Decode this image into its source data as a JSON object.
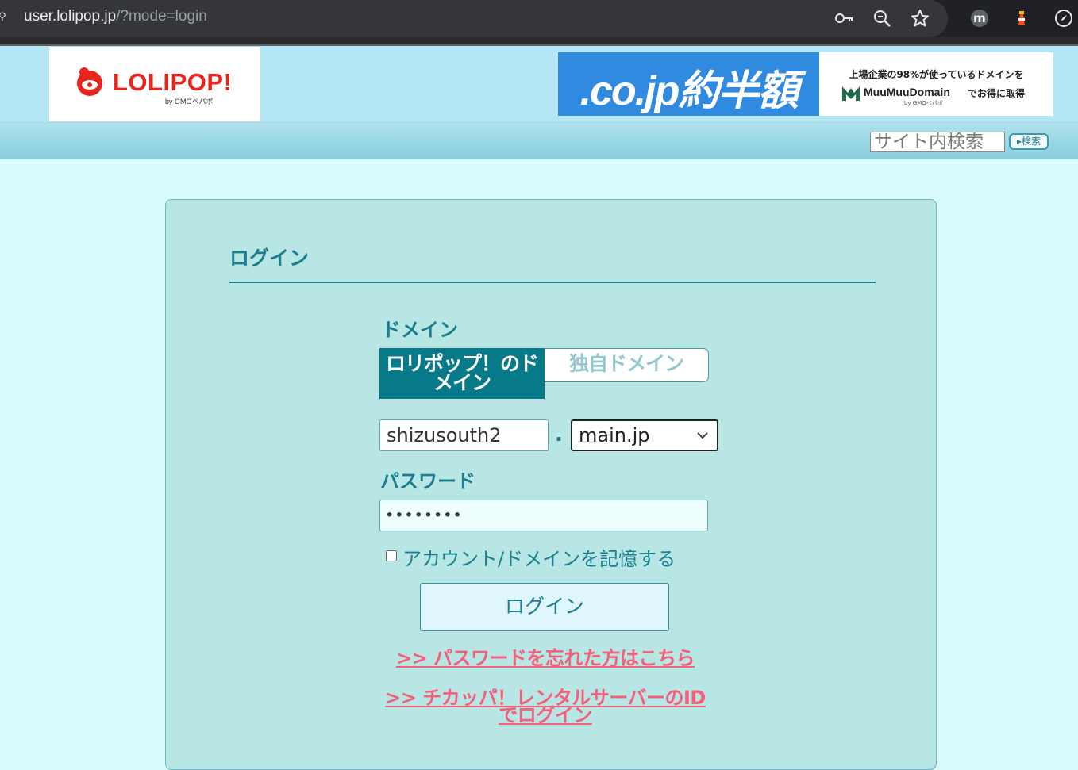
{
  "browser": {
    "url_host": "user.lolipop.jp",
    "url_path": "/?mode=login",
    "profile_initial": "m"
  },
  "header": {
    "logo_text": "LOLIPOP!",
    "logo_sub": "by GMOペパボ",
    "banner": {
      "main": ".co.jp約半額",
      "line1": "上場企業の98%が使っているドメインを",
      "brand": "MuuMuuDomain",
      "cta": "でお得に取得",
      "by": "by GMOペパボ",
      "bg_color": "#2f8ae0"
    }
  },
  "search": {
    "placeholder": "サイト内検索",
    "button_label": "▸検索"
  },
  "login": {
    "heading": "ログイン",
    "domain_label": "ドメイン",
    "tabs": [
      {
        "label": "ロリポップ！のドメイン",
        "active": true
      },
      {
        "label": "独自ドメイン",
        "active": false
      }
    ],
    "domain_value": "shizusouth2",
    "separator": ".",
    "tld_selected": "main.jp",
    "password_label": "パスワード",
    "password_value": "••••••••",
    "remember_label": "アカウント/ドメインを記憶する",
    "remember_checked": false,
    "submit_label": "ログイン",
    "links": [
      ">>  パスワードを忘れた方はこちら",
      ">>  チカッパ！レンタルサーバーのIDでログイン"
    ]
  },
  "colors": {
    "accent": "#1b7f8f",
    "tab_active": "#067a88",
    "link": "#f55f7a",
    "panel_bg": "#b7e6e4",
    "page_bg": "#d9fbfc"
  }
}
